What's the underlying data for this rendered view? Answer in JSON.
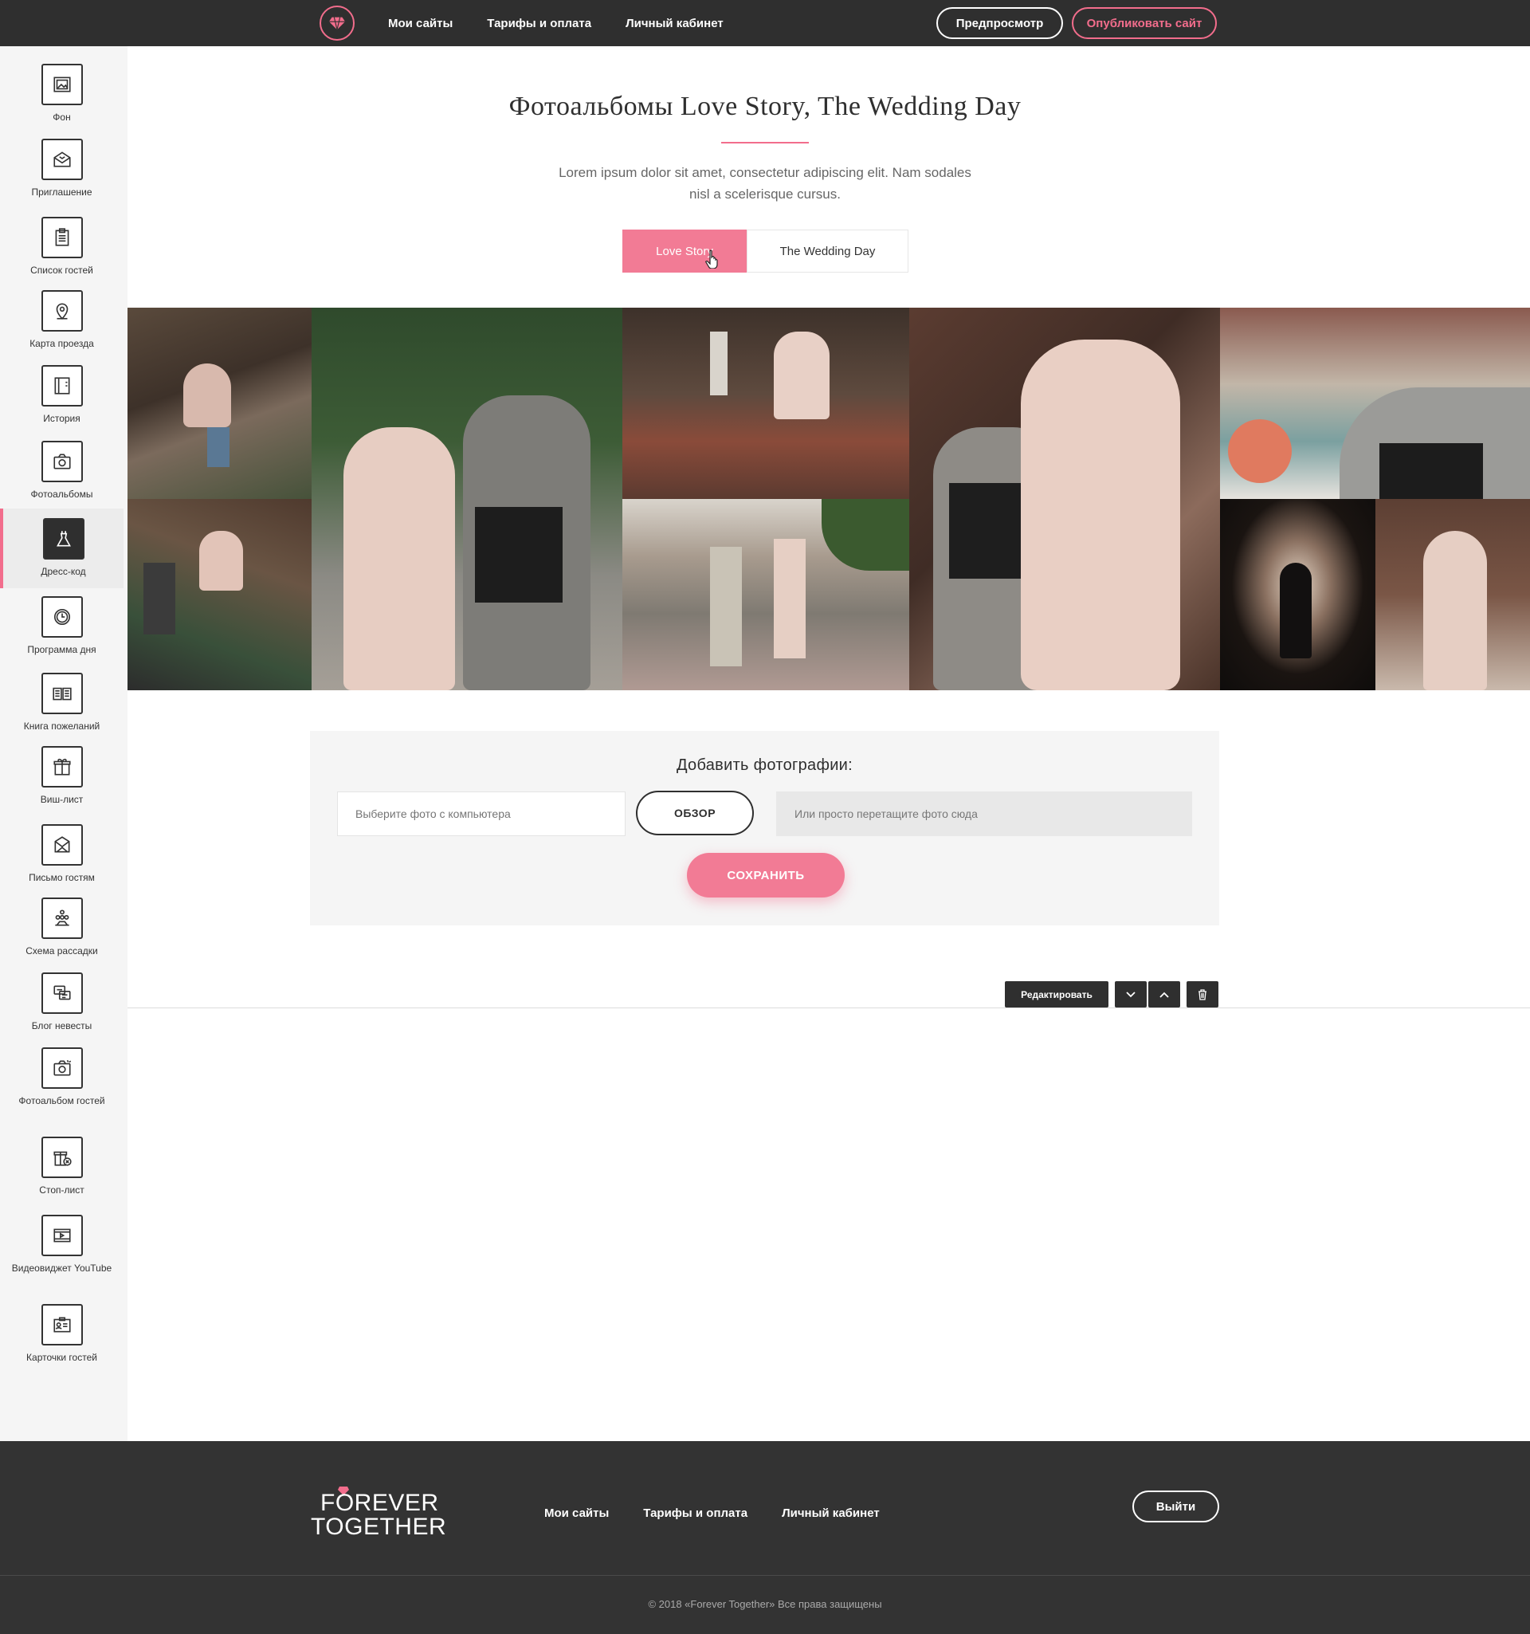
{
  "header": {
    "nav": [
      "Мои сайты",
      "Тарифы и оплата",
      "Личный кабинет"
    ],
    "preview_label": "Предпросмотр",
    "publish_label": "Опубликовать сайт"
  },
  "sidebar": {
    "items": [
      {
        "label": "Фон",
        "icon": "background-image-icon"
      },
      {
        "label": "Приглашение",
        "icon": "envelope-icon"
      },
      {
        "label": "Список гостей",
        "icon": "clipboard-list-icon"
      },
      {
        "label": "Карта проезда",
        "icon": "map-pin-icon"
      },
      {
        "label": "История",
        "icon": "book-icon"
      },
      {
        "label": "Фотоальбомы",
        "icon": "camera-icon"
      },
      {
        "label": "Дресс-код",
        "icon": "dress-icon"
      },
      {
        "label": "Программа дня",
        "icon": "clock-icon"
      },
      {
        "label": "Книга пожеланий",
        "icon": "open-book-icon"
      },
      {
        "label": "Виш-лист",
        "icon": "gift-icon"
      },
      {
        "label": "Письмо гостям",
        "icon": "letter-icon"
      },
      {
        "label": "Схема рассадки",
        "icon": "seating-icon"
      },
      {
        "label": "Блог невесты",
        "icon": "chat-icon"
      },
      {
        "label": "Фотоальбом гостей",
        "icon": "guest-camera-icon"
      },
      {
        "label": "Стоп-лист",
        "icon": "gift-cancel-icon"
      },
      {
        "label": "Видеовиджет YouTube",
        "icon": "video-icon"
      },
      {
        "label": "Карточки гостей",
        "icon": "guest-card-icon"
      }
    ],
    "active": "Дресс-код"
  },
  "main": {
    "title": "Фотоальбомы Love Story, The Wedding Day",
    "subtitle": "Lorem ipsum dolor sit amet, consectetur adipiscing elit. Nam sodales nisl a scelerisque cursus.",
    "tabs": [
      {
        "label": "Love Story",
        "active": true
      },
      {
        "label": "The Wedding Day",
        "active": false
      }
    ]
  },
  "upload": {
    "title": "Добавить фотографии:",
    "file_placeholder": "Выберите фото с компьютера",
    "browse_label": "ОБЗОР",
    "drop_label": "Или просто перетащите фото сюда",
    "save_label": "СОХРАНИТЬ"
  },
  "toolbar": {
    "edit_label": "Редактировать"
  },
  "footer": {
    "logo_line1": "FOREVER",
    "logo_line2": "TOGETHER",
    "nav": [
      "Мои сайты",
      "Тарифы и оплата",
      "Личный кабинет"
    ],
    "logout_label": "Выйти",
    "copyright": "© 2018 «Forever Together» Все права защищены"
  },
  "colors": {
    "accent": "#f27b95",
    "dark": "#2f2f2f",
    "sidebar_bg": "#f5f5f5"
  }
}
